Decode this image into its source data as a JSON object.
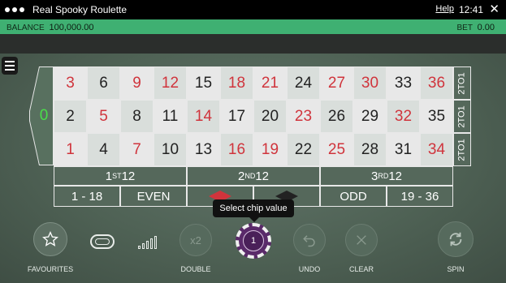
{
  "window": {
    "title": "Real Spooky Roulette",
    "help_label": "Help",
    "time": "12:41",
    "close_glyph": "✕"
  },
  "balance_bar": {
    "balance_label": "BALANCE",
    "balance_value": "100,000.00",
    "bet_label": "BET",
    "bet_value": "0.00"
  },
  "table": {
    "zero": "0",
    "rows": [
      [
        {
          "n": "3",
          "c": "red"
        },
        {
          "n": "6",
          "c": "black"
        },
        {
          "n": "9",
          "c": "red"
        },
        {
          "n": "12",
          "c": "red"
        },
        {
          "n": "15",
          "c": "black"
        },
        {
          "n": "18",
          "c": "red"
        },
        {
          "n": "21",
          "c": "red"
        },
        {
          "n": "24",
          "c": "black"
        },
        {
          "n": "27",
          "c": "red"
        },
        {
          "n": "30",
          "c": "red"
        },
        {
          "n": "33",
          "c": "black"
        },
        {
          "n": "36",
          "c": "red"
        }
      ],
      [
        {
          "n": "2",
          "c": "black"
        },
        {
          "n": "5",
          "c": "red"
        },
        {
          "n": "8",
          "c": "black"
        },
        {
          "n": "11",
          "c": "black"
        },
        {
          "n": "14",
          "c": "red"
        },
        {
          "n": "17",
          "c": "black"
        },
        {
          "n": "20",
          "c": "black"
        },
        {
          "n": "23",
          "c": "red"
        },
        {
          "n": "26",
          "c": "black"
        },
        {
          "n": "29",
          "c": "black"
        },
        {
          "n": "32",
          "c": "red"
        },
        {
          "n": "35",
          "c": "black"
        }
      ],
      [
        {
          "n": "1",
          "c": "red"
        },
        {
          "n": "4",
          "c": "black"
        },
        {
          "n": "7",
          "c": "red"
        },
        {
          "n": "10",
          "c": "black"
        },
        {
          "n": "13",
          "c": "black"
        },
        {
          "n": "16",
          "c": "red"
        },
        {
          "n": "19",
          "c": "red"
        },
        {
          "n": "22",
          "c": "black"
        },
        {
          "n": "25",
          "c": "red"
        },
        {
          "n": "28",
          "c": "black"
        },
        {
          "n": "31",
          "c": "black"
        },
        {
          "n": "34",
          "c": "red"
        }
      ]
    ],
    "column_bet_label": "2TO1",
    "dozens": [
      {
        "num": "1",
        "sup": "ST",
        "rest": "12"
      },
      {
        "num": "2",
        "sup": "ND",
        "rest": "12"
      },
      {
        "num": "3",
        "sup": "RD",
        "rest": "12"
      }
    ],
    "outside": [
      "1 - 18",
      "EVEN",
      "",
      "",
      "ODD",
      "19 - 36"
    ],
    "colors": {
      "red": "#d0343c",
      "black": "#222222",
      "zero": "#4ade4a"
    }
  },
  "tooltip": "Select chip value",
  "controls": {
    "favourites_label": "FAVOURITES",
    "double_label": "DOUBLE",
    "double_text": "x2",
    "chip_value": "1",
    "undo_label": "UNDO",
    "clear_label": "CLEAR",
    "spin_label": "SPIN"
  }
}
